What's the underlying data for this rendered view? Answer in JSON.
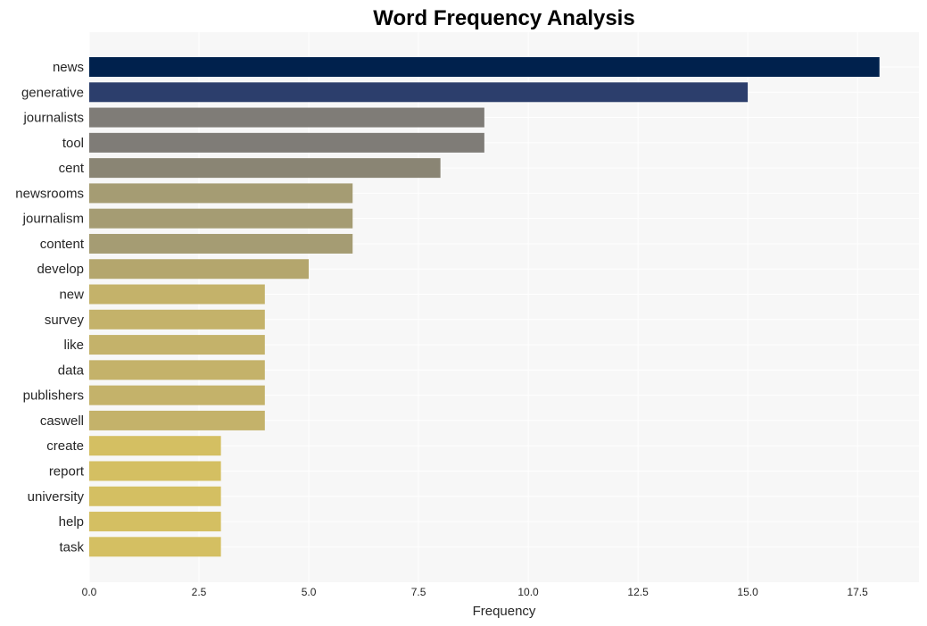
{
  "chart_data": {
    "type": "bar",
    "orientation": "horizontal",
    "title": "Word Frequency Analysis",
    "xlabel": "Frequency",
    "ylabel": "",
    "xlim": [
      0,
      18.9
    ],
    "xticks": [
      0.0,
      2.5,
      5.0,
      7.5,
      10.0,
      12.5,
      15.0,
      17.5
    ],
    "xtick_labels": [
      "0.0",
      "2.5",
      "5.0",
      "7.5",
      "10.0",
      "12.5",
      "15.0",
      "17.5"
    ],
    "grid": true,
    "legend": "none",
    "categories": [
      "news",
      "generative",
      "journalists",
      "tool",
      "cent",
      "newsrooms",
      "journalism",
      "content",
      "develop",
      "new",
      "survey",
      "like",
      "data",
      "publishers",
      "caswell",
      "create",
      "report",
      "university",
      "help",
      "task"
    ],
    "values": [
      18,
      15,
      9,
      9,
      8,
      6,
      6,
      6,
      5,
      4,
      4,
      4,
      4,
      4,
      4,
      3,
      3,
      3,
      3,
      3
    ],
    "colors": [
      "#00214d",
      "#2c3e6c",
      "#7f7c77",
      "#7f7c77",
      "#8a8574",
      "#a59c73",
      "#a59c73",
      "#a59c73",
      "#b4a66d",
      "#c4b26a",
      "#c4b26a",
      "#c4b26a",
      "#c4b26a",
      "#c4b26a",
      "#c4b26a",
      "#d4bf62",
      "#d4bf62",
      "#d4bf62",
      "#d4bf62",
      "#d4bf62"
    ],
    "plot_background": "#f7f7f7",
    "grid_color": "#ffffff"
  }
}
